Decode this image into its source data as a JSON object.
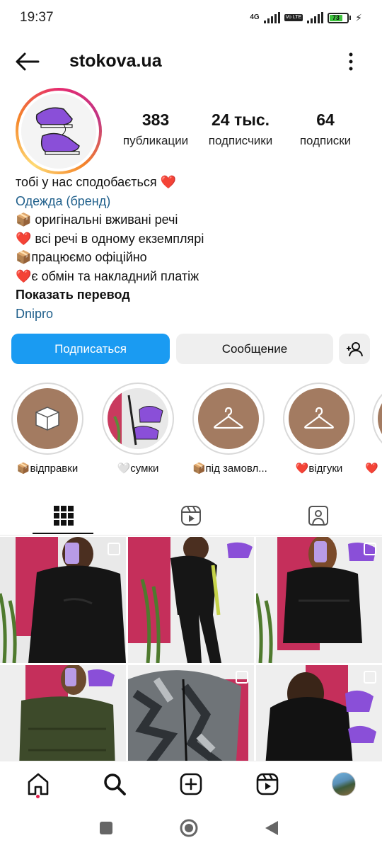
{
  "status_bar": {
    "time": "19:37",
    "network_1": "4G",
    "network_2": "Vo LTE",
    "battery": "73"
  },
  "header": {
    "username": "stokova.ua"
  },
  "stats": [
    {
      "value": "383",
      "label": "публикации"
    },
    {
      "value": "24 тыс.",
      "label": "подписчики"
    },
    {
      "value": "64",
      "label": "подписки"
    }
  ],
  "bio": {
    "line1": "тобі у нас сподобається ❤️",
    "category": "Одежда (бренд)",
    "line2": "📦 оригінальні вживані речі",
    "line3": "❤️ всі речі в одному екземплярі",
    "line4": "📦працюємо офіційно",
    "line5": "❤️є обмін та накладний платіж",
    "translate": "Показать перевод",
    "location": "Dnipro"
  },
  "buttons": {
    "follow": "Подписаться",
    "message": "Сообщение"
  },
  "highlights": [
    {
      "label": "📦відправки",
      "icon": "box-icon"
    },
    {
      "label": "🤍сумки",
      "icon": "photo"
    },
    {
      "label": "📦під замовл...",
      "icon": "hanger-icon"
    },
    {
      "label": "❤️відгуки",
      "icon": "hanger-icon"
    },
    {
      "label": "❤️",
      "icon": "hanger-icon"
    }
  ],
  "colors": {
    "accent": "#1a9bf2",
    "highlight_bg": "#a37b61",
    "link": "#1f5f8b"
  }
}
